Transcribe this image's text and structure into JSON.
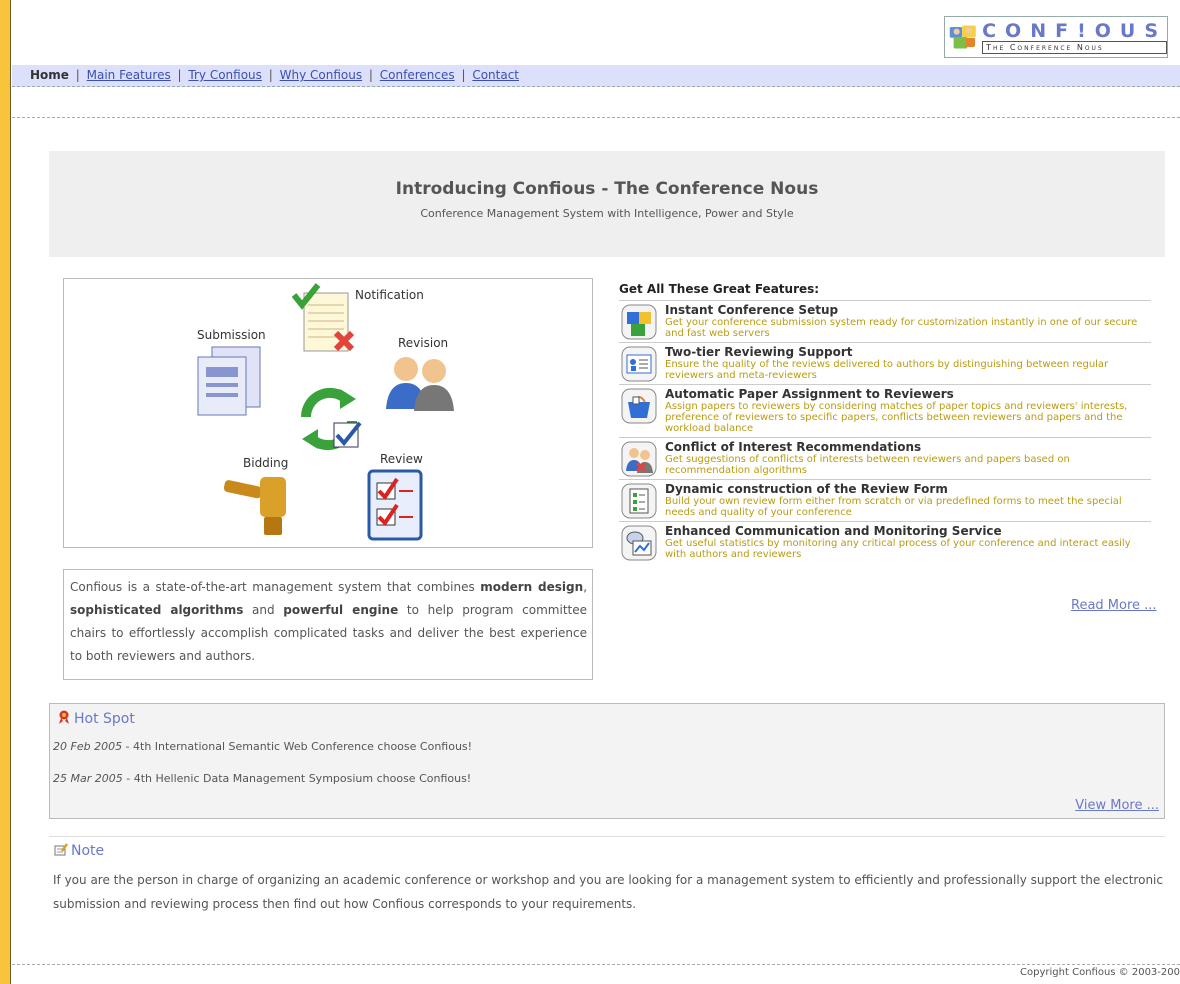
{
  "logo": {
    "word": "CONF!OUS",
    "tagline": "The Conference Nous"
  },
  "nav": {
    "home": "Home",
    "links": [
      "Main Features",
      "Try Confious",
      "Why Confious",
      "Conferences",
      "Contact"
    ],
    "separator": "|"
  },
  "intro": {
    "title": "Introducing Confious - The Conference Nous",
    "subtitle": "Conference Management System with Intelligence, Power and Style"
  },
  "workflow": {
    "labels": {
      "notification": "Notification",
      "submission": "Submission",
      "revision": "Revision",
      "bidding": "Bidding",
      "review": "Review"
    }
  },
  "description": {
    "p1": "Confious is a state-of-the-art management system that combines ",
    "b1": "modern design",
    "p2": ", ",
    "b2": "sophisticated algorithms",
    "p3": " and ",
    "b3": "powerful engine",
    "p4": " to help program committee chairs to effortlessly accomplish complicated tasks and deliver the best experience to both reviewers and authors."
  },
  "features": {
    "heading": "Get All These Great Features:",
    "items": [
      {
        "title": "Instant Conference Setup",
        "text": "Get your conference submission system ready for customization instantly in one of our secure and fast web servers",
        "icon": "cubes-icon"
      },
      {
        "title": "Two-tier Reviewing Support",
        "text": "Ensure the quality of the reviews delivered to authors by distinguishing between regular reviewers and meta-reviewers",
        "icon": "id-card-icon"
      },
      {
        "title": "Automatic Paper Assignment to Reviewers",
        "text": "Assign papers to reviewers by considering matches of paper topics and reviewers' interests, preference of reviewers to specific papers, conflicts between reviewers and papers and the workload balance",
        "icon": "basket-icon"
      },
      {
        "title": "Conflict of Interest Recommendations",
        "text": "Get suggestions of conflicts of interests between reviewers and papers based on recommendation algorithms",
        "icon": "conflict-users-icon"
      },
      {
        "title": "Dynamic construction of the Review Form",
        "text": "Build your own review form either from scratch or via predefined forms to meet the special needs and quality of your conference",
        "icon": "form-icon"
      },
      {
        "title": "Enhanced Communication and Monitoring Service",
        "text": "Get useful statistics by monitoring any critical process of your conference and interact easily with authors and reviewers",
        "icon": "monitor-chart-icon"
      }
    ],
    "read_more": "Read More ..."
  },
  "hotspot": {
    "title": "Hot Spot",
    "items": [
      {
        "date": "20 Feb 2005",
        "text": " - 4th International Semantic Web Conference choose Confious!"
      },
      {
        "date": "25 Mar 2005",
        "text": " - 4th Hellenic Data Management Symposium choose Confious!"
      }
    ],
    "view_more": "View More ..."
  },
  "note": {
    "title": "Note",
    "text": "If you are the person in charge of organizing an academic conference or workshop and you are looking for a management system to efficiently and professionally support the electronic submission and reviewing process then find out how Confious corresponds to your requirements."
  },
  "footer": {
    "copyright": "Copyright Confious © 2003-200"
  },
  "colors": {
    "accent": "#6a78c8",
    "nav_bg": "#dde0fb",
    "feature_text": "#b89c12",
    "left_strip": "#f7c43c"
  }
}
